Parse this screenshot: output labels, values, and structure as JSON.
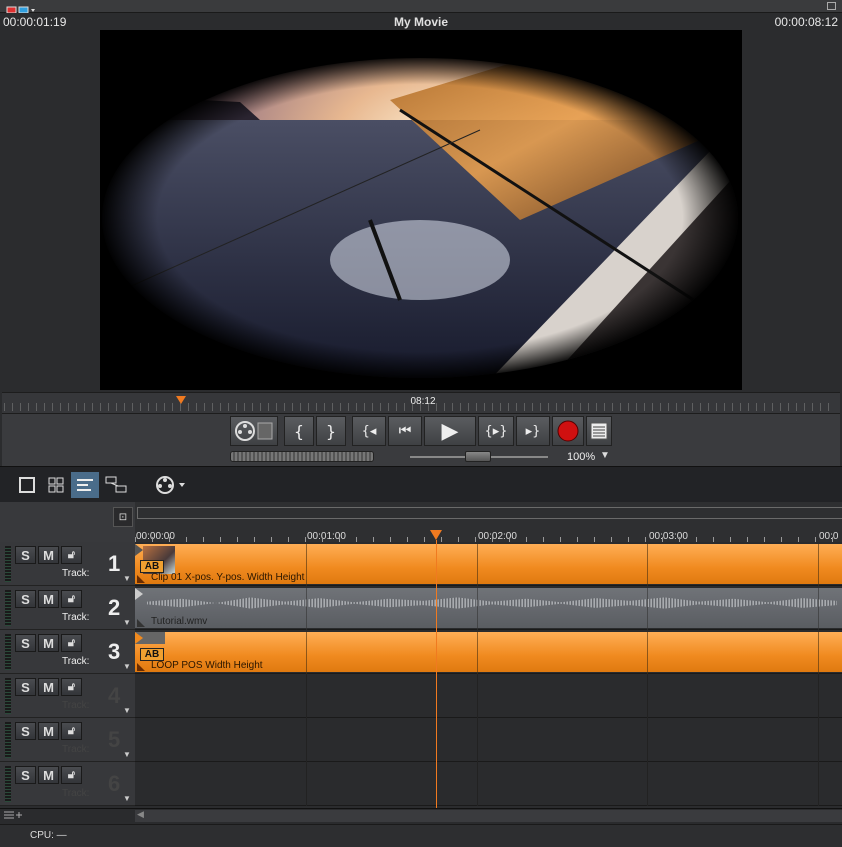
{
  "window": {
    "title": "My Movie",
    "timecode_current": "00:00:01:19",
    "timecode_total": "00:00:08:12"
  },
  "preview": {
    "mini_timeline_time": "08:12"
  },
  "transport": {
    "buttons": [
      "film-reel-icon",
      "set-in-icon",
      "set-out-icon",
      "prev-marker-icon",
      "go-start-icon",
      "play-icon",
      "loop-range-icon",
      "next-marker-icon",
      "record-icon",
      "menu-icon"
    ],
    "zoom": "100%"
  },
  "toolbar": {
    "modes": [
      "single-view-icon",
      "grid-view-icon",
      "timeline-view-icon",
      "storyboard-icon",
      "film-reel-dropdown-icon"
    ]
  },
  "ruler": {
    "labels": [
      "00:00:00",
      "00:01:00",
      "00:02:00",
      "00:03:00",
      "00:0"
    ],
    "playhead_time": "00:01:19"
  },
  "tracks": [
    {
      "number": "1",
      "label": "Track:",
      "solo": "S",
      "mute": "M",
      "clip": {
        "type": "video",
        "name": "Clip 01   X-pos.  Y-pos.  Width  Height",
        "badge": "AB"
      }
    },
    {
      "number": "2",
      "label": "Track:",
      "solo": "S",
      "mute": "M",
      "clip": {
        "type": "audio",
        "name": "Tutorial.wmv"
      }
    },
    {
      "number": "3",
      "label": "Track:",
      "solo": "S",
      "mute": "M",
      "clip": {
        "type": "video",
        "name": "LOOP POS   Width  Height",
        "badge": "AB"
      }
    },
    {
      "number": "4",
      "label": "Track:",
      "solo": "S",
      "mute": "M"
    },
    {
      "number": "5",
      "label": "Track:",
      "solo": "S",
      "mute": "M"
    },
    {
      "number": "6",
      "label": "Track:",
      "solo": "S",
      "mute": "M"
    }
  ],
  "status": {
    "cpu": "CPU: —"
  },
  "colors": {
    "accent": "#f07a20",
    "clip_orange": "#f08a1f",
    "record": "#d01010"
  }
}
